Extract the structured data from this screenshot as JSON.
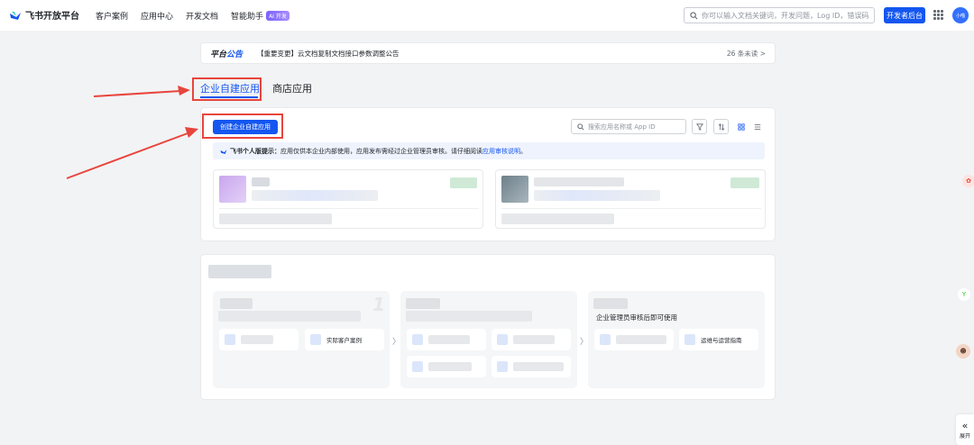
{
  "topbar": {
    "logo_text": "飞书开放平台",
    "nav": [
      "客户案例",
      "应用中心",
      "开发文档",
      "智能助手"
    ],
    "ai_badge": "AI 开发",
    "search_placeholder": "你可以输入文档关键词，开发问题，Log ID，错误码",
    "dev_console": "开发者后台",
    "avatar_text": "小喵"
  },
  "announcement": {
    "title_a": "平台",
    "title_b": "公告",
    "text": "【重要变更】云文档复制文档接口参数调整公告",
    "unread": "26 条未读",
    "unread_arrow": ">"
  },
  "tabs": {
    "custom_apps": "企业自建应用",
    "store_apps": "商店应用"
  },
  "main": {
    "create_button": "创建企业自建应用",
    "search_placeholder": "搜索应用名称或 App ID",
    "tip_title": "飞书个人版提示：",
    "tip_text": "应用仅供本企业内部使用，应用发布需经过企业管理员审核。请仔细阅读",
    "tip_link": "应用审核说明",
    "tip_end": "。"
  },
  "guide": {
    "step3_desc": "企业管理员审核后即可使用",
    "step1_item2": "实际客户案例",
    "step3_item2": "运维与运营指南",
    "step1_number": "1"
  },
  "sidebar": {
    "collapse_label": "展开",
    "collapse_icon": "«"
  },
  "colors": {
    "primary": "#1456f0",
    "highlight": "#e8453c"
  }
}
